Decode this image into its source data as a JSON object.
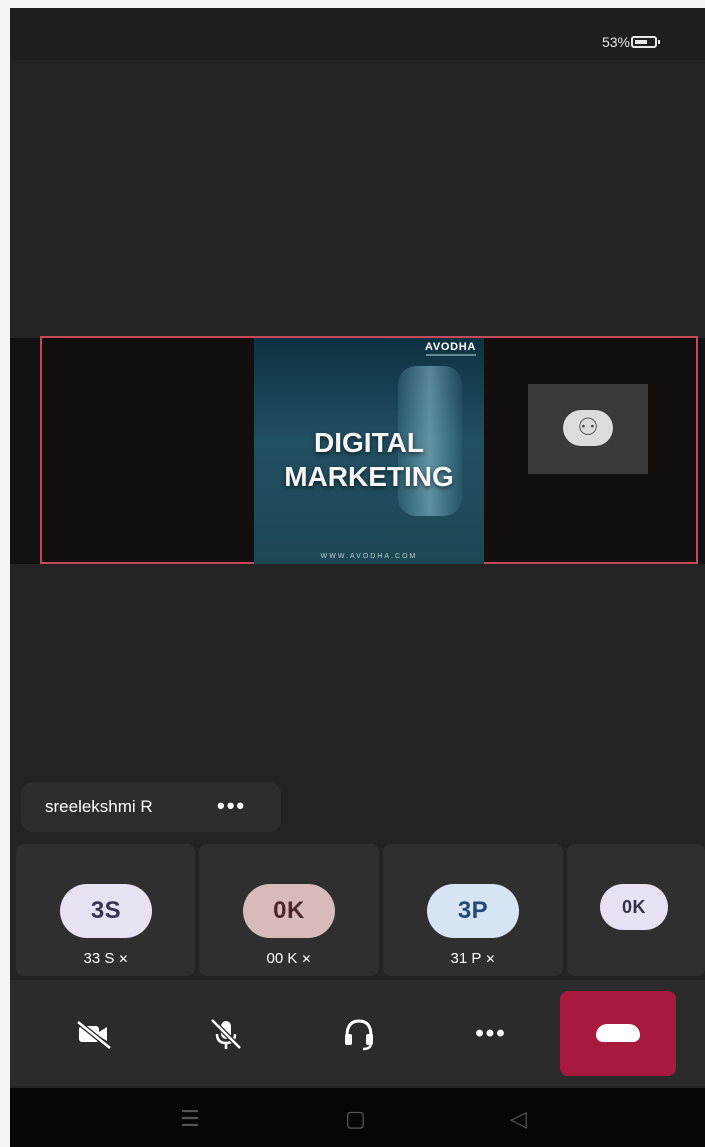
{
  "status_bar": {
    "battery_percent": "53%"
  },
  "slide": {
    "brand": "AVODHA",
    "title": "DIGITAL MARKETING",
    "url": "WWW.AVODHA.COM"
  },
  "presenter": {
    "name": "sreelekshmi R",
    "more": "•••"
  },
  "participants": [
    {
      "initials": "3S",
      "name": "33 S",
      "avatar_bg": "#e7e1f2",
      "avatar_fg": "#3a3450"
    },
    {
      "initials": "0K",
      "name": "00 K",
      "avatar_bg": "#d8baba",
      "avatar_fg": "#4d2727"
    },
    {
      "initials": "3P",
      "name": "31 P",
      "avatar_bg": "#d6e4f4",
      "avatar_fg": "#234a76"
    },
    {
      "initials": "0K",
      "name": "",
      "avatar_bg": "#e6e1f3",
      "avatar_fg": "#353045"
    }
  ],
  "toolbar": {
    "video_icon": "video-off-icon",
    "mic_icon": "mic-off-icon",
    "audio_icon": "headset-icon",
    "more_icon": "more-icon",
    "end_icon": "end-call-icon",
    "more_label": "•••"
  },
  "colors": {
    "end_call": "#a7193f",
    "share_border": "#c34a5b"
  }
}
